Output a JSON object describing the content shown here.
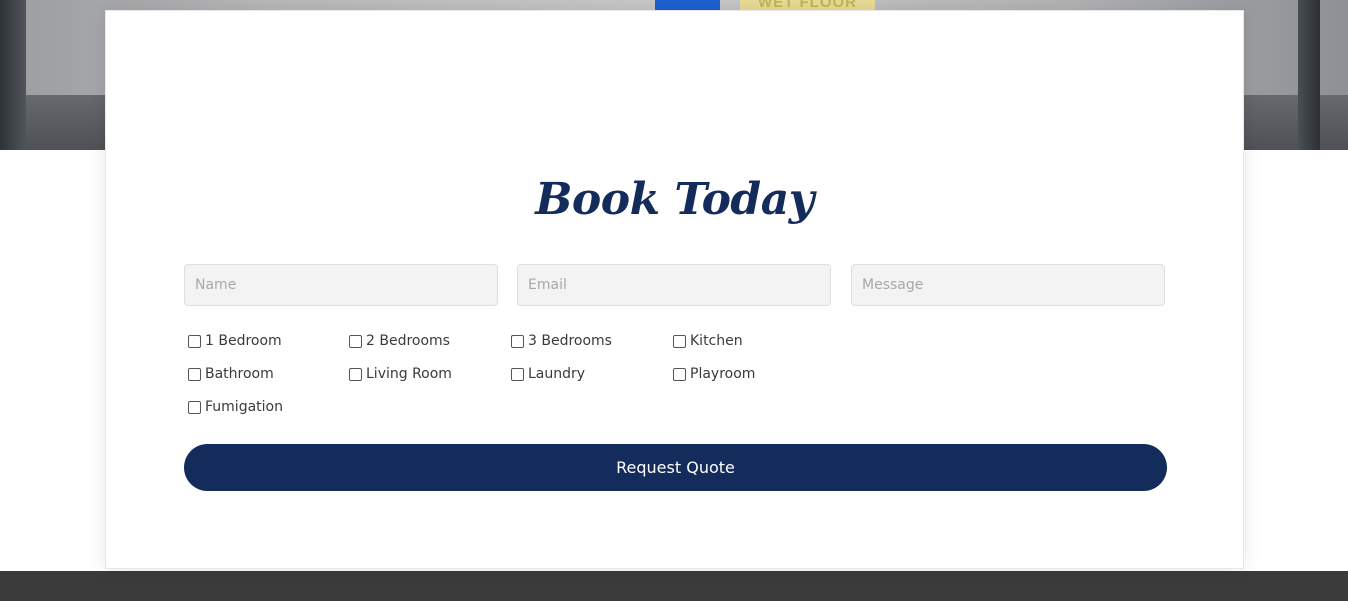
{
  "hero": {
    "sign_text": "WET FLOOR"
  },
  "form": {
    "title": "Book Today",
    "name_placeholder": "Name",
    "email_placeholder": "Email",
    "message_placeholder": "Message",
    "options": [
      {
        "label": "1 Bedroom",
        "checked": false
      },
      {
        "label": "2 Bedrooms",
        "checked": false
      },
      {
        "label": "3 Bedrooms",
        "checked": false
      },
      {
        "label": "Kitchen",
        "checked": false
      },
      {
        "label": "Bathroom",
        "checked": false
      },
      {
        "label": "Living Room",
        "checked": false
      },
      {
        "label": "Laundry",
        "checked": false
      },
      {
        "label": "Playroom",
        "checked": false
      },
      {
        "label": "Fumigation",
        "checked": false
      }
    ],
    "submit_label": "Request Quote"
  },
  "colors": {
    "brand_navy": "#132c5b",
    "field_bg": "#f3f3f3",
    "footer_bg": "#3b3b3b"
  }
}
